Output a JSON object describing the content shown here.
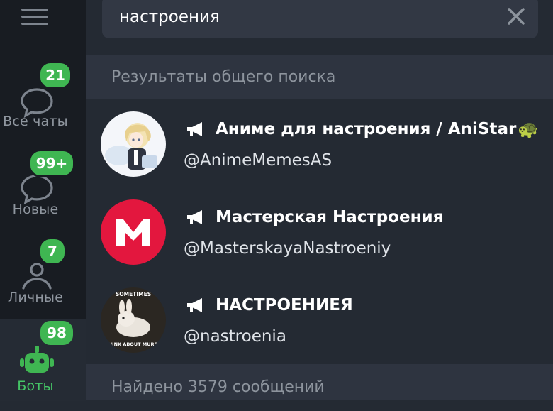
{
  "colors": {
    "rail_bg": "#181c22",
    "main_bg": "#242a33",
    "section_header_bg": "#2e3440",
    "search_box_bg": "#323844",
    "accent_green": "#3fb652",
    "active_label": "#45c566",
    "muted_text": "#8d949d"
  },
  "rail": {
    "menu_icon": "hamburger-icon",
    "folders": [
      {
        "label": "Все чаты",
        "badge": "21",
        "icon": "chats-icon",
        "active": false
      },
      {
        "label": "Новые",
        "badge": "99+",
        "icon": "new-chat-icon",
        "active": false
      },
      {
        "label": "Личные",
        "badge": "7",
        "icon": "user-icon",
        "active": false
      },
      {
        "label": "Боты",
        "badge": "98",
        "icon": "bot-icon",
        "active": true
      }
    ]
  },
  "search": {
    "value": "настроения",
    "clear_icon": "close-icon"
  },
  "global_results": {
    "header": "Результаты общего поиска",
    "items": [
      {
        "title": "Аниме для настроения / AniStar",
        "emoji": "🐢",
        "handle": "@AnimeMemesAS",
        "type_icon": "megaphone-icon"
      },
      {
        "title": "Мастерская Настроения",
        "emoji": "",
        "handle": "@MasterskayaNastroeniy",
        "type_icon": "megaphone-icon"
      },
      {
        "title": "НАСТРОЕНИЕЯ",
        "emoji": "",
        "handle": "@nastroenia",
        "type_icon": "megaphone-icon",
        "avatar_text_top": "SOMETIMES",
        "avatar_text_bottom": "I THINK ABOUT MURDER"
      }
    ]
  },
  "messages": {
    "header": "Найдено 3579 сообщений"
  }
}
